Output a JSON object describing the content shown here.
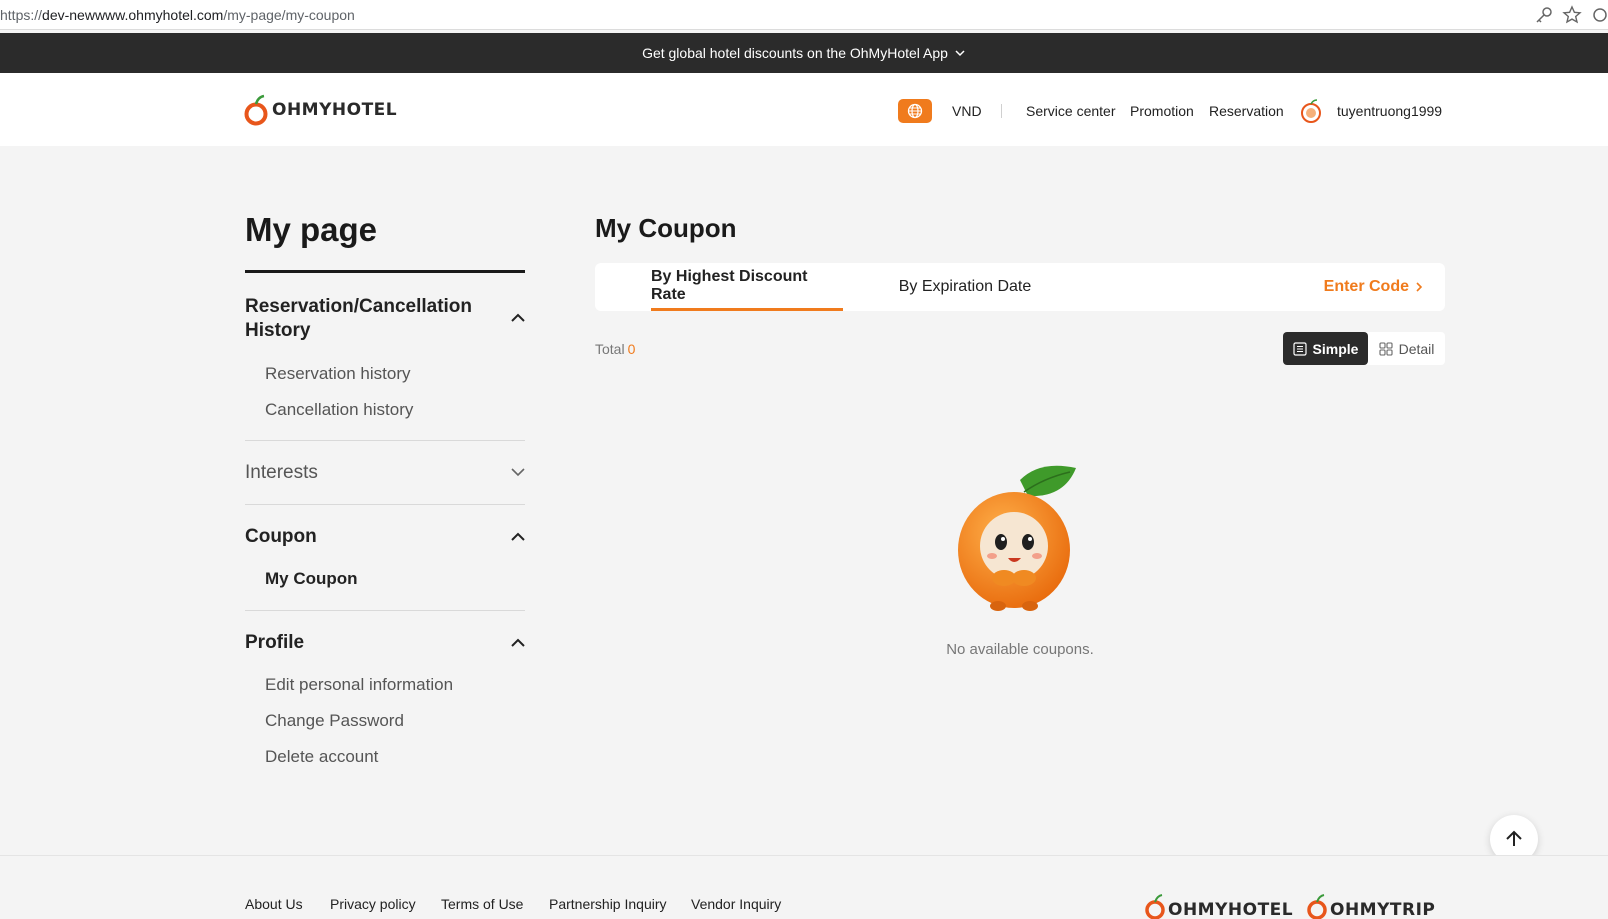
{
  "browser": {
    "url_prefix": "https://",
    "url_host": "dev-newwww.ohmyhotel.com",
    "url_path": "/my-page/my-coupon"
  },
  "promo": {
    "text": "Get global hotel discounts on the OhMyHotel App"
  },
  "header": {
    "logo_text": "OHMYHOTEL",
    "currency": "VND",
    "nav": [
      "Service center",
      "Promotion",
      "Reservation"
    ],
    "username": "tuyentruong1999"
  },
  "sidebar": {
    "title": "My page",
    "sections": [
      {
        "title_line1": "Reservation/Cancellation",
        "title_line2": "History",
        "items": [
          "Reservation history",
          "Cancellation history"
        ]
      },
      {
        "title": "Interests"
      },
      {
        "title": "Coupon",
        "items": [
          "My Coupon"
        ]
      },
      {
        "title": "Profile",
        "items": [
          "Edit personal information",
          "Change Password",
          "Delete account"
        ]
      }
    ]
  },
  "main": {
    "title": "My Coupon",
    "tabs": [
      "By Highest Discount Rate",
      "By Expiration Date"
    ],
    "enter_code": "Enter Code",
    "total_label": "Total",
    "total_count": "0",
    "view_toggle": [
      "Simple",
      "Detail"
    ],
    "empty_message": "No available coupons."
  },
  "footer": {
    "links": [
      "About Us",
      "Privacy policy",
      "Terms of Use",
      "Partnership Inquiry",
      "Vendor Inquiry"
    ],
    "logos": [
      "OHMYHOTEL",
      "OHMYTRIP"
    ]
  },
  "colors": {
    "accent": "#f07b1d",
    "dark": "#2b2b2b"
  }
}
